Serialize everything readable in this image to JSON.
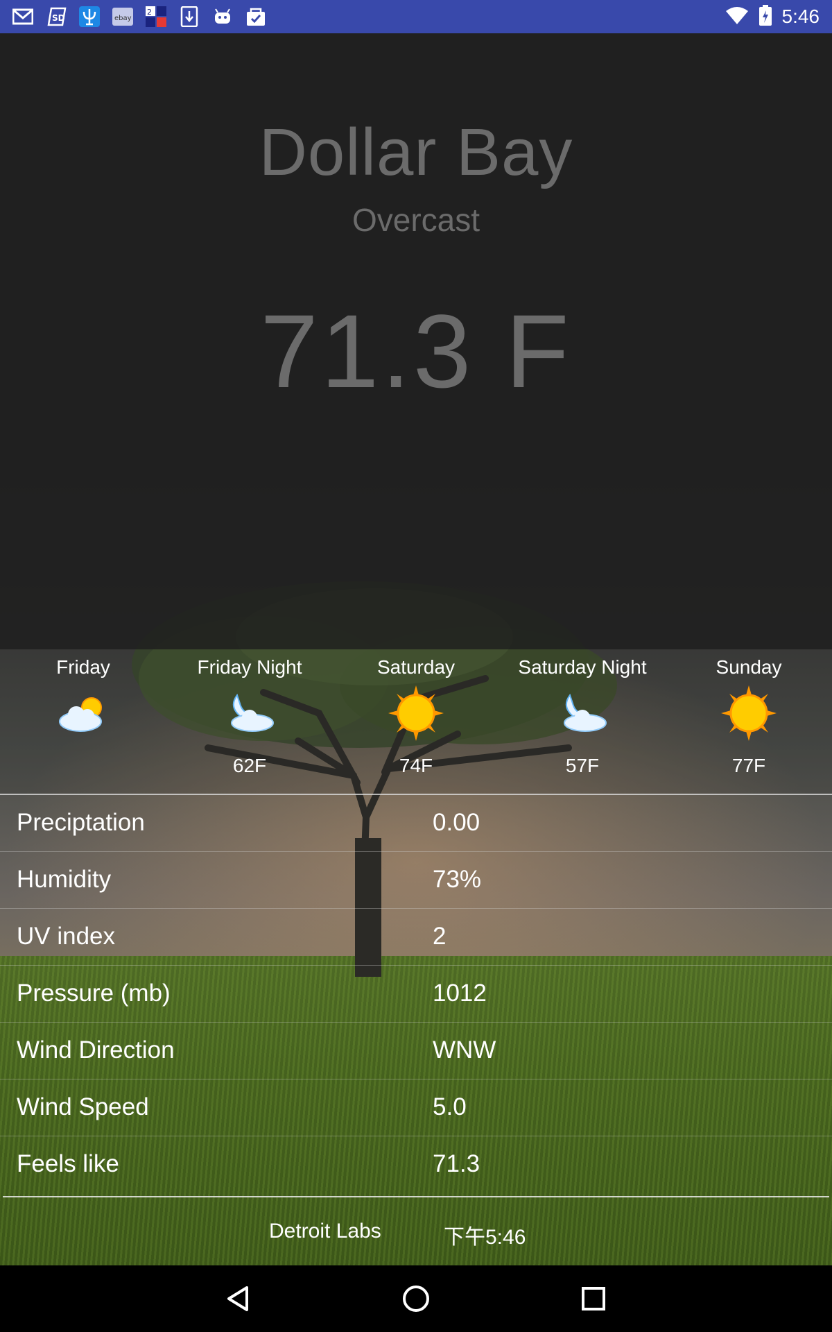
{
  "status_bar": {
    "time": "5:46",
    "notification_icons": [
      "gmail-icon",
      "sd-card-icon",
      "trident-app-icon",
      "ebay-icon",
      "multi-app-icon",
      "download-icon",
      "android-icon",
      "clipboard-check-icon"
    ],
    "status_icons": [
      "wifi-icon",
      "battery-icon"
    ]
  },
  "header": {
    "city": "Dollar Bay",
    "condition": "Overcast",
    "temperature": "71.3 F"
  },
  "forecast": [
    {
      "day": "Friday",
      "icon": "partly-cloudy-icon",
      "temp": ""
    },
    {
      "day": "Friday Night",
      "icon": "cloudy-night-icon",
      "temp": "62F"
    },
    {
      "day": "Saturday",
      "icon": "sun-icon",
      "temp": "74F"
    },
    {
      "day": "Saturday Night",
      "icon": "cloudy-night-icon",
      "temp": "57F"
    },
    {
      "day": "Sunday",
      "icon": "sun-icon",
      "temp": "77F"
    }
  ],
  "details": [
    {
      "label": "Preciptation",
      "value": "0.00"
    },
    {
      "label": "Humidity",
      "value": "73%"
    },
    {
      "label": "UV index",
      "value": "2"
    },
    {
      "label": "Pressure (mb)",
      "value": "1012"
    },
    {
      "label": "Wind Direction",
      "value": "WNW"
    },
    {
      "label": "Wind Speed",
      "value": "5.0"
    },
    {
      "label": "Feels like",
      "value": "71.3"
    }
  ],
  "footer": {
    "provider": "Detroit Labs",
    "updated": "下午5:46"
  },
  "nav": {
    "icons": [
      "back-icon",
      "home-icon",
      "recents-icon"
    ]
  },
  "colors": {
    "status_bar": "#3949ab",
    "header_text": "#6b6b6b",
    "sun": "#ffcc00",
    "cloud": "#e8f4ff"
  }
}
